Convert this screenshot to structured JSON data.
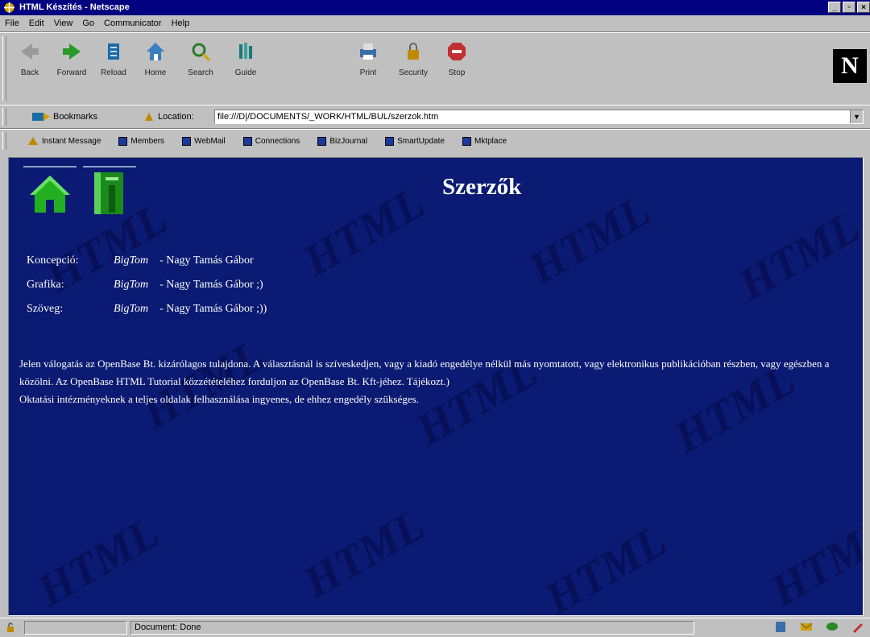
{
  "window": {
    "title": "HTML Készítés - Netscape"
  },
  "menu": [
    "File",
    "Edit",
    "View",
    "Go",
    "Communicator",
    "Help"
  ],
  "toolbar": {
    "buttons": [
      {
        "label": "Back"
      },
      {
        "label": "Forward"
      },
      {
        "label": "Reload"
      },
      {
        "label": "Home"
      },
      {
        "label": "Search"
      },
      {
        "label": "Guide"
      },
      {
        "label": "Print"
      },
      {
        "label": "Security"
      },
      {
        "label": "Stop"
      }
    ],
    "logo": "N"
  },
  "location": {
    "bookmarks_label": "Bookmarks",
    "location_label": "Location:",
    "url": "file:///D|/DOCUMENTS/_WORK/HTML/BUL/szerzok.htm"
  },
  "personal_toolbar": [
    "Instant Message",
    "Members",
    "WebMail",
    "Connections",
    "BizJournal",
    "SmartUpdate",
    "Mktplace"
  ],
  "page": {
    "title": "Szerzők",
    "home_icon": "house-icon",
    "index_icon": "book-icon",
    "credits": [
      {
        "role": "Koncepció:",
        "nick": "BigTom",
        "name": "- Nagy Tamás Gábor"
      },
      {
        "role": "Grafika:",
        "nick": "BigTom",
        "name": "- Nagy Tamás Gábor ;)"
      },
      {
        "role": "Szöveg:",
        "nick": "BigTom",
        "name": "- Nagy Tamás Gábor ;))"
      }
    ],
    "paragraph1": "Jelen válogatás az OpenBase Bt. kizárólagos tulajdona. A választásnál is szíveskedjen, vagy a kiadó engedélye nélkül más nyomtatott, vagy elektronikus publikációban részben, vagy egészben a közölni. Az OpenBase HTML Tutorial közzétételéhez forduljon az OpenBase Bt. Kft-jéhez. Tájékozt.)",
    "paragraph2": "Oktatási intézményeknek a teljes oldalak felhasználása ingyenes, de ehhez engedély szükséges."
  },
  "status": {
    "message": "Document: Done"
  },
  "colors": {
    "titlebar": "#000080",
    "page_bg": "#0b1a72",
    "chrome": "#c0c0c0"
  }
}
